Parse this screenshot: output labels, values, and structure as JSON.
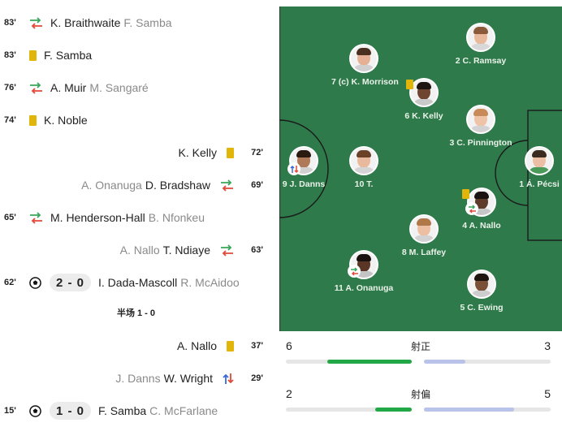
{
  "timeline": {
    "events": [
      {
        "side": "left",
        "minute": "83'",
        "type": "sub",
        "player": "K. Braithwaite",
        "sub": "F. Samba"
      },
      {
        "side": "left",
        "minute": "83'",
        "type": "yellow",
        "player": "F. Samba"
      },
      {
        "side": "left",
        "minute": "76'",
        "type": "sub",
        "player": "A. Muir",
        "sub": "M. Sangaré"
      },
      {
        "side": "left",
        "minute": "74'",
        "type": "yellow",
        "player": "K. Noble"
      },
      {
        "side": "right",
        "minute": "72'",
        "type": "yellow",
        "player": "K. Kelly"
      },
      {
        "side": "right",
        "minute": "69'",
        "type": "sub",
        "player": "D. Bradshaw",
        "sub": "A. Onanuga"
      },
      {
        "side": "left",
        "minute": "65'",
        "type": "sub",
        "player": "M. Henderson-Hall",
        "sub": "B. Nfonkeu"
      },
      {
        "side": "right",
        "minute": "63'",
        "type": "sub",
        "player": "T. Ndiaye",
        "sub": "A. Nallo"
      },
      {
        "side": "left",
        "minute": "62'",
        "type": "goal",
        "score": "2 - 0",
        "player": "I. Dada-Mascoll",
        "sub": "R. McAidoo"
      },
      {
        "side": "right",
        "minute": "37'",
        "type": "yellow",
        "player": "A. Nallo"
      },
      {
        "side": "right",
        "minute": "29'",
        "type": "sub",
        "player": "W. Wright",
        "sub": "J. Danns"
      },
      {
        "side": "left",
        "minute": "15'",
        "type": "goal",
        "score": "1 - 0",
        "player": "F. Samba",
        "sub": "C. McFarlane"
      }
    ],
    "halftime": "半场 1 - 0"
  },
  "pitch": {
    "players": [
      {
        "label": "2 C. Ramsay",
        "skin": "#e9b99d",
        "hair": "#8a5a3a",
        "shirt": "#d8d8d8"
      },
      {
        "label": "7 (c) K. Morrison",
        "skin": "#e5b196",
        "hair": "#4a3020",
        "shirt": "#d0d0d0"
      },
      {
        "label": "6 K. Kelly",
        "skin": "#6e4530",
        "hair": "#1e1410",
        "shirt": "#c9c9c9"
      },
      {
        "label": "3 C. Pinnington",
        "skin": "#efc3a8",
        "hair": "#c98a5a",
        "shirt": "#d3d3d3"
      },
      {
        "label": "9 J. Danns",
        "skin": "#b07a5a",
        "hair": "#2a1a10",
        "shirt": "#d0d0d0"
      },
      {
        "label": "10 T.",
        "skin": "#e9b99d",
        "hair": "#6b4228",
        "shirt": "#d4d4d4"
      },
      {
        "label": "1 Á. Pécsi",
        "skin": "#eabfa5",
        "hair": "#3a2a20",
        "shirt": "#4a9a5a"
      },
      {
        "label": "4 A. Nallo",
        "skin": "#5e3a28",
        "hair": "#1a1210",
        "shirt": "#c6c6c6"
      },
      {
        "label": "8 M. Laffey",
        "skin": "#ecbfa3",
        "hair": "#b07848",
        "shirt": "#d2d2d2"
      },
      {
        "label": "11 A. Onanuga",
        "skin": "#5a3626",
        "hair": "#1a1210",
        "shirt": "#c4c4c4"
      },
      {
        "label": "5 C. Ewing",
        "skin": "#7a5038",
        "hair": "#1e1410",
        "shirt": "#cdcdcd"
      }
    ]
  },
  "stats": [
    {
      "label": "射正",
      "left": "6",
      "right": "3",
      "left_frac": 0.67,
      "right_frac": 0.33
    },
    {
      "label": "射偏",
      "left": "2",
      "right": "5",
      "left_frac": 0.29,
      "right_frac": 0.71
    }
  ],
  "colors": {
    "pitch": "#2e7a4a",
    "yellow_card": "#e2b50a",
    "stat_left": "#22a846",
    "stat_right": "#b9c3ea",
    "sub_arrow_green": "#3aa65a",
    "sub_arrow_red": "#e2493a"
  }
}
